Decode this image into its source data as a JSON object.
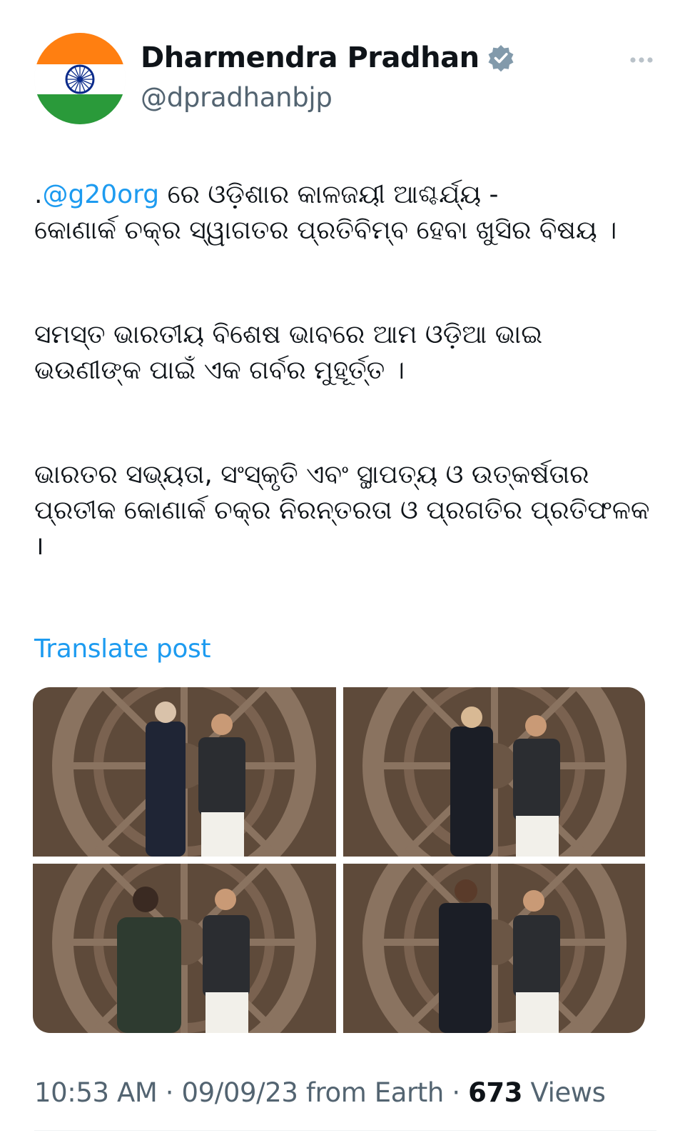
{
  "author": {
    "display_name": "Dharmendra Pradhan",
    "handle": "@dpradhanbjp",
    "avatar_icon": "india-flag-avatar",
    "verified_icon": "verified-badge-icon",
    "verified_color": "#829aab"
  },
  "tweet": {
    "para1_mention": "@g20org",
    "para1_lead": ".",
    "para1_rest": " ରେ ଓଡ଼ିଶାର କାଳଜୟୀ ଆଶ୍ଚର୍ଯ୍ୟ -\nକୋଣାର୍କ ଚକ୍ର ସ୍ୱାଗତର ପ୍ରତିବିମ୍ବ ହେବା ଖୁସିର ବିଷୟ ।",
    "para2": "ସମସ୍ତ ଭାରତୀୟ ବିଶେଷ ଭାବରେ ଆମ ଓଡ଼ିଆ ଭାଇ\nଭଉଣୀଙ୍କ ପାଇଁ ଏକ ଗର୍ବର ମୁହୂର୍ତ୍ତ ।",
    "para3": "ଭାରତର ସଭ୍ୟତା, ସଂସ୍କୃତି ଏବଂ ସ୍ଥାପତ୍ୟ ଓ ଉତ୍କର୍ଷତାର\nପ୍ରତୀକ କୋଣାର୍କ ଚକ୍ର ନିରନ୍ତରତା ଓ ପ୍ରଗତିର ପ୍ରତିଫଳକ\n।"
  },
  "translate_label": "Translate post",
  "meta": {
    "time": "10:53 AM",
    "sep1": " · ",
    "date": "09/09/23",
    "source": " from Earth",
    "sep2": " · ",
    "views_count": "673",
    "views_label": " Views"
  },
  "colors": {
    "accent": "#1d9bf0",
    "text": "#0f1419",
    "secondary": "#536471",
    "flag_saffron": "#ff7f11",
    "flag_green": "#2a9a3a",
    "chakra": "#0a2a8a"
  },
  "icons": {
    "more": "more-options-icon"
  }
}
